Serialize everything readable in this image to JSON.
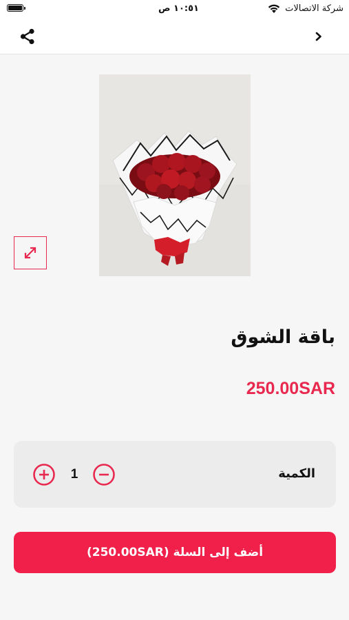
{
  "status_bar": {
    "carrier": "شركة الاتصالات",
    "time": "١٠:٥١ ص"
  },
  "nav": {
    "share_icon": "share-icon",
    "back_icon": "chevron-right-icon"
  },
  "product": {
    "title": "باقة الشوق",
    "price": "250.00SAR",
    "image_icon": "bouquet-image",
    "expand_icon": "expand-icon"
  },
  "quantity": {
    "label": "الكمية",
    "value": "1",
    "plus_icon": "plus-circle-icon",
    "minus_icon": "minus-circle-icon"
  },
  "cart": {
    "button_label": "أضف إلى السلة (250.00SAR)"
  },
  "colors": {
    "accent": "#e8284e",
    "button_bg": "#f1204a",
    "page_bg": "#f6f6f6"
  }
}
